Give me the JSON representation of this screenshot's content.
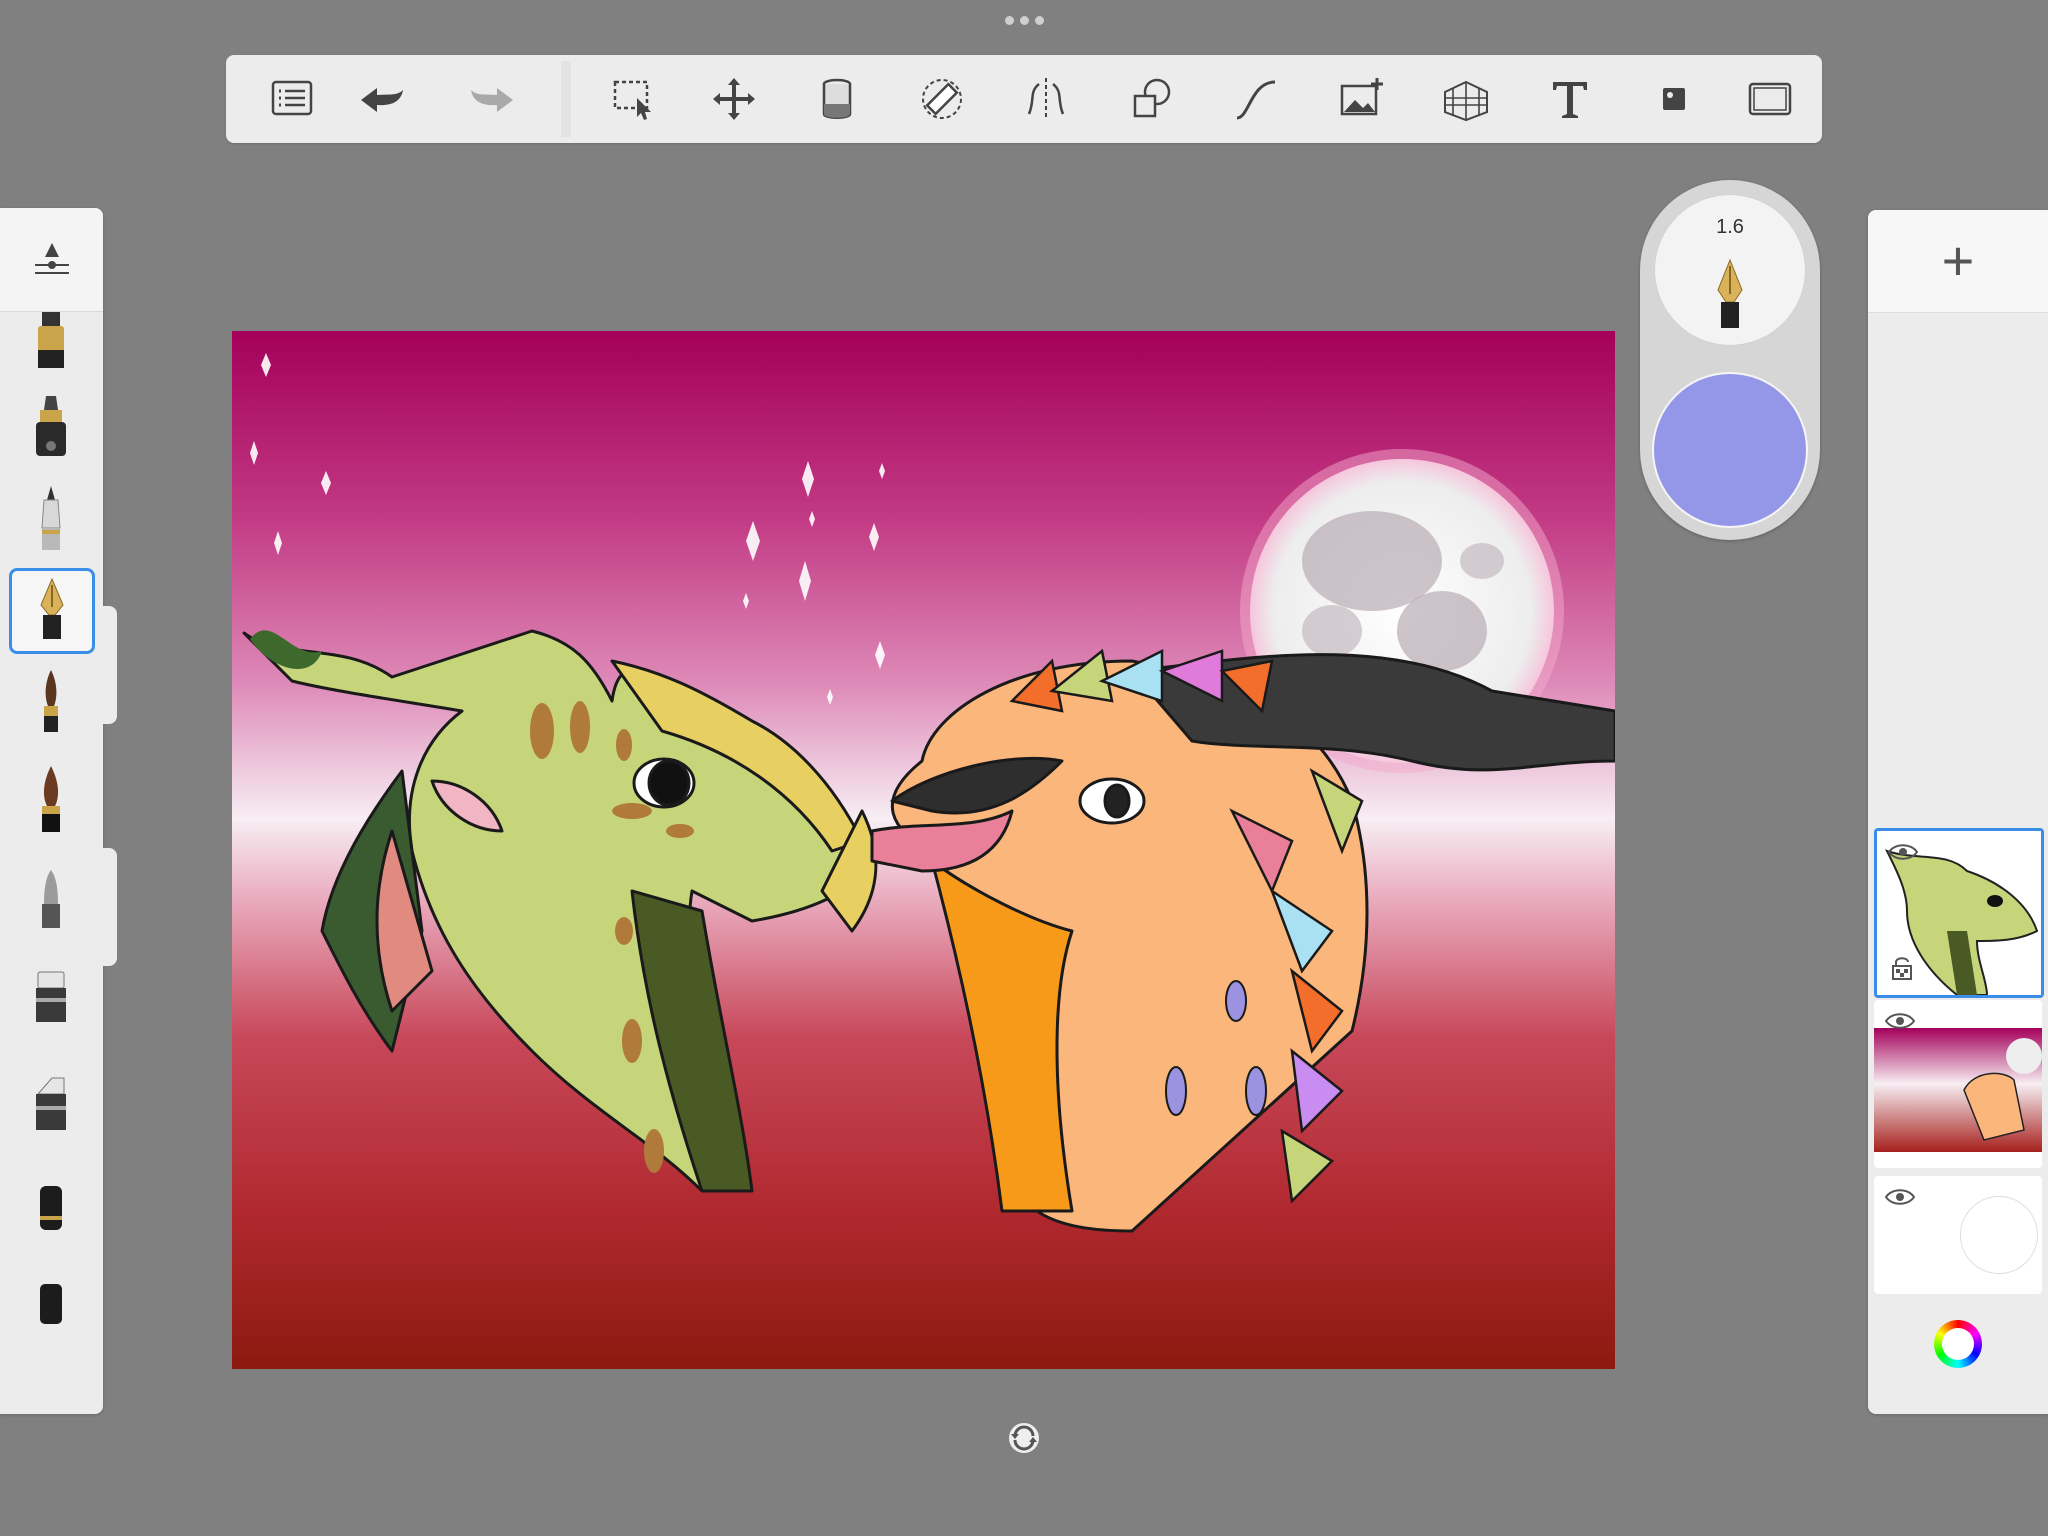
{
  "window": {
    "menu_dots": "more-options"
  },
  "toolbar": {
    "items": [
      {
        "name": "gallery-list",
        "icon": "list-icon"
      },
      {
        "name": "undo",
        "icon": "undo-arrow-icon"
      },
      {
        "name": "redo",
        "icon": "redo-arrow-icon"
      },
      {
        "name": "selection",
        "icon": "selection-icon"
      },
      {
        "name": "transform",
        "icon": "move-icon"
      },
      {
        "name": "fill",
        "icon": "paint-bucket-icon"
      },
      {
        "name": "ruler",
        "icon": "ruler-icon"
      },
      {
        "name": "symmetry",
        "icon": "symmetry-icon"
      },
      {
        "name": "shapes",
        "icon": "shapes-icon"
      },
      {
        "name": "curve",
        "icon": "curve-icon"
      },
      {
        "name": "import-image",
        "icon": "add-image-icon"
      },
      {
        "name": "perspective",
        "icon": "perspective-grid-icon"
      },
      {
        "name": "text",
        "icon": "text-icon"
      },
      {
        "name": "fill-tool",
        "icon": "stamp-icon"
      },
      {
        "name": "fullscreen",
        "icon": "fullscreen-icon"
      }
    ]
  },
  "brush_panel": {
    "selected_index": 3,
    "brushes": [
      {
        "name": "pencil",
        "icon": "pencil-brush-icon"
      },
      {
        "name": "marker",
        "icon": "marker-brush-icon"
      },
      {
        "name": "ballpoint",
        "icon": "ballpoint-brush-icon"
      },
      {
        "name": "fountain-pen",
        "icon": "fountain-pen-icon"
      },
      {
        "name": "paint-brush",
        "icon": "paint-brush-icon"
      },
      {
        "name": "brush-dark",
        "icon": "ink-brush-icon"
      },
      {
        "name": "airbrush",
        "icon": "airbrush-icon"
      },
      {
        "name": "eraser-1",
        "icon": "eraser-icon"
      },
      {
        "name": "eraser-2",
        "icon": "soft-eraser-icon"
      },
      {
        "name": "blender",
        "icon": "blender-icon"
      }
    ]
  },
  "brush_puck": {
    "size_value": "1.6",
    "brush_icon": "fountain-pen-icon",
    "current_color": "#9496e8"
  },
  "layers": {
    "add_label": "+",
    "items": [
      {
        "name": "dragon-line-art",
        "visible": true,
        "locked": true,
        "active": true
      },
      {
        "name": "background-scene",
        "visible": true,
        "locked": false,
        "active": false
      },
      {
        "name": "blank-layer",
        "visible": true,
        "locked": false,
        "active": false
      }
    ]
  },
  "colors": {
    "accent": "#3b8ee8",
    "background": "#808080"
  }
}
